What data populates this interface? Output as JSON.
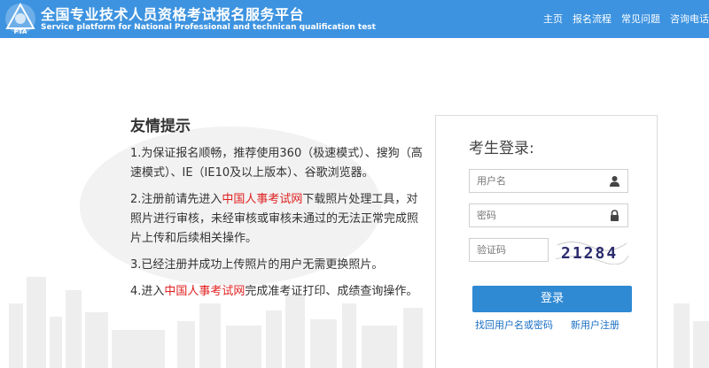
{
  "header": {
    "logo_text": "PTA",
    "title_cn": "全国专业技术人员资格考试报名服务平台",
    "title_en": "Service platform for National Professional and technican qualification test",
    "nav": [
      "主页",
      "报名流程",
      "常见问题",
      "咨询电话"
    ]
  },
  "tips": {
    "title": "友情提示",
    "items": [
      {
        "text": "1.为保证报名顺畅，推荐使用360（极速模式）、搜狗（高速模式）、IE（IE10及以上版本）、谷歌浏览器。"
      },
      {
        "pre": "2.注册前请先进入",
        "link": "中国人事考试网",
        "post": "下载照片处理工具，对照片进行审核，未经审核或审核未通过的无法正常完成照片上传和后续相关操作。"
      },
      {
        "text": "3.已经注册并成功上传照片的用户无需更换照片。"
      },
      {
        "pre": "4.进入",
        "link": "中国人事考试网",
        "post": "完成准考证打印、成绩查询操作。"
      }
    ]
  },
  "login": {
    "title": "考生登录:",
    "username_placeholder": "用户名",
    "password_placeholder": "密码",
    "captcha_placeholder": "验证码",
    "captcha_text": "21284",
    "submit": "登录",
    "forgot": "找回用户名或密码",
    "register": "新用户注册"
  },
  "colors": {
    "header_bg": "#3d93e0",
    "button_bg": "#2f8ad3",
    "link_red": "#e02020",
    "link_blue": "#1a6fc4"
  }
}
